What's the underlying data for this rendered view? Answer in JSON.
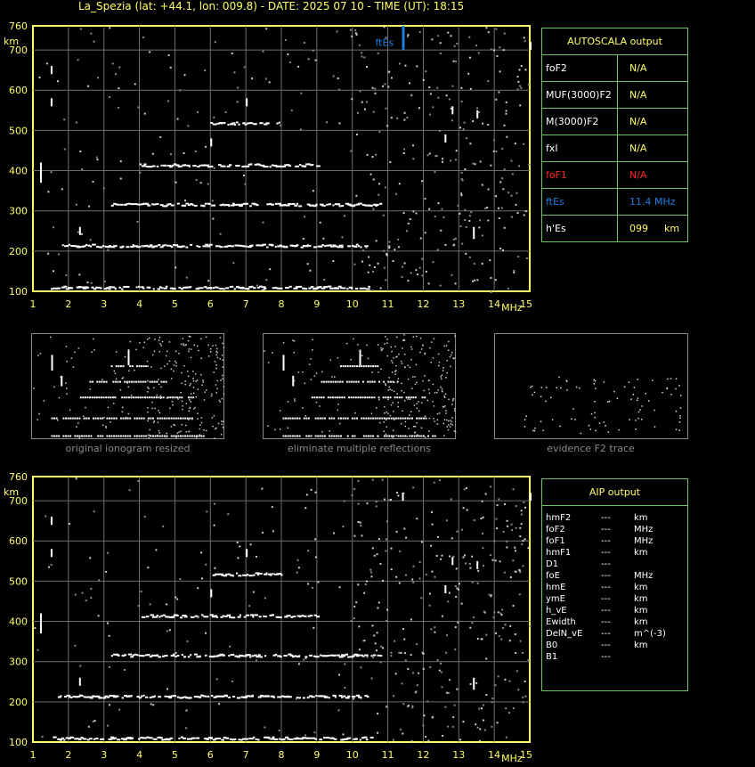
{
  "header": {
    "title": "La_Spezia (lat: +44.1, lon: 009.8) - DATE: 2025 07 10 - TIME (UT): 18:15"
  },
  "ionogram": {
    "y_unit": "km",
    "x_unit": "MHz",
    "y_ticks": [
      "760",
      "700",
      "600",
      "500",
      "400",
      "300",
      "200",
      "100"
    ],
    "x_ticks": [
      "1",
      "2",
      "3",
      "4",
      "5",
      "6",
      "7",
      "8",
      "9",
      "10",
      "11",
      "12",
      "13",
      "14",
      "15"
    ],
    "marker_label": "ftEs",
    "colors": {
      "axis": "#ffff66",
      "grid": "#6d6d6d",
      "trace": "#ffffff",
      "marker": "#1e7de0"
    }
  },
  "chart_data": [
    {
      "type": "scatter",
      "title": "",
      "xlabel": "MHz",
      "ylabel": "km",
      "xlim": [
        1,
        15
      ],
      "ylim": [
        100,
        760
      ],
      "grid": true,
      "series": [
        {
          "x": [
            1.5,
            2,
            3,
            4,
            5,
            6,
            7,
            8,
            9,
            10,
            10.5
          ],
          "y": [
            112,
            112,
            112,
            112,
            112,
            112,
            112,
            112,
            112,
            112,
            112
          ]
        },
        {
          "x": [
            1.7,
            2.5,
            3.5,
            4.5,
            5.5,
            6.5,
            7.5,
            8.5,
            9.5,
            10.5
          ],
          "y": [
            216,
            216,
            216,
            216,
            216,
            216,
            216,
            216,
            216,
            216
          ]
        },
        {
          "x": [
            3.2,
            4,
            5,
            6,
            7,
            8,
            9,
            10,
            10.8
          ],
          "y": [
            318,
            318,
            318,
            318,
            318,
            318,
            318,
            318,
            318
          ]
        },
        {
          "x": [
            4,
            5,
            6,
            7,
            8,
            9
          ],
          "y": [
            416,
            416,
            416,
            416,
            416,
            416
          ]
        },
        {
          "x": [
            6,
            7,
            8
          ],
          "y": [
            520,
            520,
            520
          ]
        }
      ]
    }
  ],
  "autoscala": {
    "title": "AUTOSCALA output",
    "rows": [
      {
        "label": "foF2",
        "value": "N/A"
      },
      {
        "label": "MUF(3000)F2",
        "value": "N/A"
      },
      {
        "label": "M(3000)F2",
        "value": "N/A"
      },
      {
        "label": "fxI",
        "value": "N/A"
      },
      {
        "label": "foF1",
        "value": "N/A"
      },
      {
        "label": "ftEs",
        "value": "11.4 MHz"
      },
      {
        "label": "h'Es",
        "value": "099",
        "unit": "km"
      }
    ],
    "colors": {
      "label_yellow": "#ffff66",
      "foF1": "#ff2020",
      "ftEs": "#1e7de0"
    }
  },
  "thumbs": [
    {
      "caption": "original ionogram resized"
    },
    {
      "caption": "eliminate multiple reflections"
    },
    {
      "caption": "evidence F2 trace"
    }
  ],
  "aip": {
    "title": "AIP output",
    "rows": [
      {
        "label": "hmF2",
        "value": "---",
        "unit": "km"
      },
      {
        "label": "foF2",
        "value": "---",
        "unit": "MHz"
      },
      {
        "label": "foF1",
        "value": "---",
        "unit": "MHz"
      },
      {
        "label": "hmF1",
        "value": "---",
        "unit": "km"
      },
      {
        "label": "D1",
        "value": "---",
        "unit": ""
      },
      {
        "label": "foE",
        "value": "---",
        "unit": "MHz"
      },
      {
        "label": "hmE",
        "value": "---",
        "unit": "km"
      },
      {
        "label": "ymE",
        "value": "---",
        "unit": "km"
      },
      {
        "label": "h_vE",
        "value": "---",
        "unit": "km"
      },
      {
        "label": "Ewidth",
        "value": "---",
        "unit": "km"
      },
      {
        "label": "DelN_vE",
        "value": "---",
        "unit": "m^(-3)"
      },
      {
        "label": "B0",
        "value": "---",
        "unit": "km"
      },
      {
        "label": "B1",
        "value": "---",
        "unit": ""
      }
    ]
  }
}
